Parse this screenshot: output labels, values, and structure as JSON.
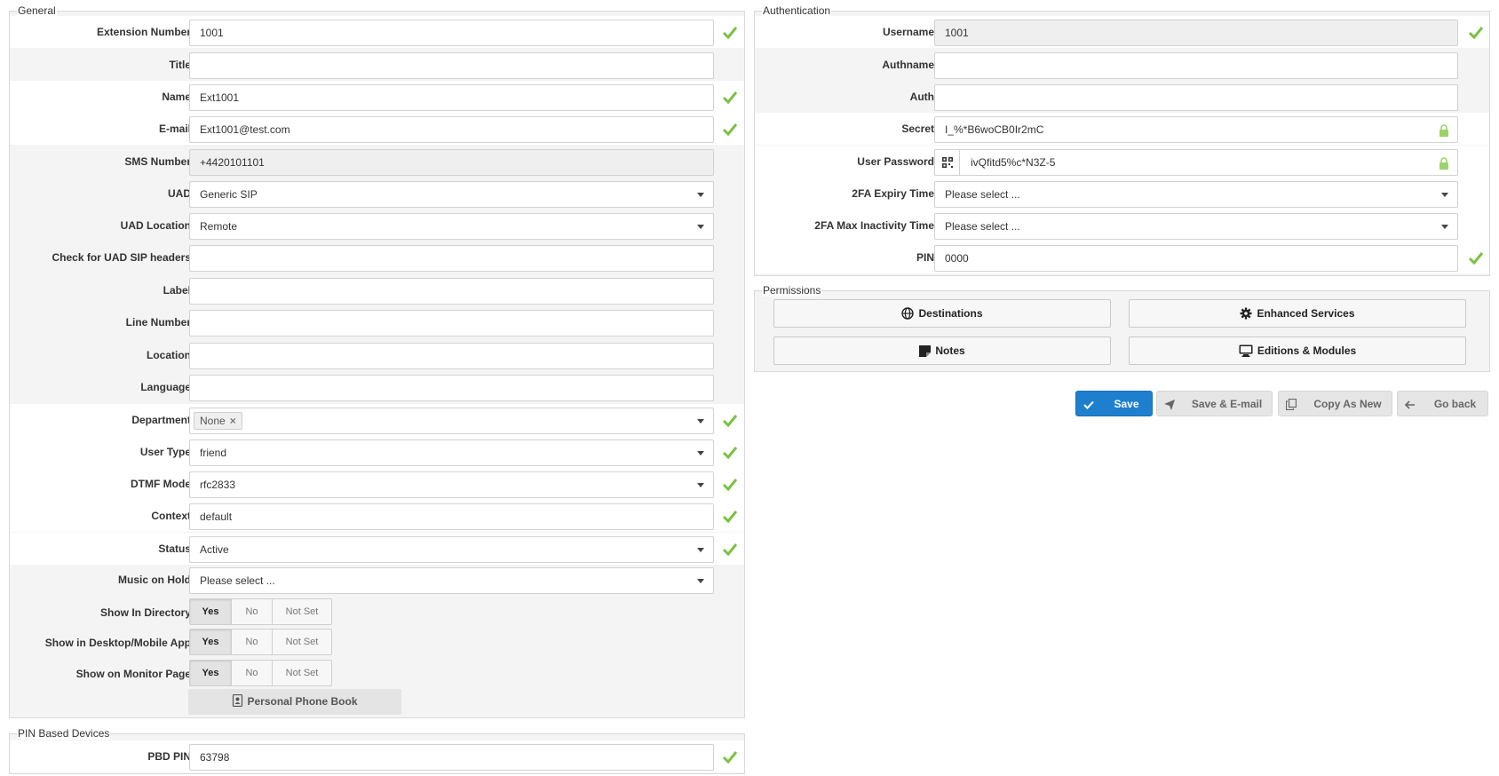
{
  "general": {
    "legend": "General",
    "extension_number": {
      "label": "Extension Number:",
      "value": "1001"
    },
    "title": {
      "label": "Title:",
      "value": ""
    },
    "name": {
      "label": "Name:",
      "value": "Ext1001"
    },
    "email": {
      "label": "E-mail:",
      "value": "Ext1001@test.com"
    },
    "sms_number": {
      "label": "SMS Number:",
      "value": "+4420101101"
    },
    "uad": {
      "label": "UAD:",
      "value": "Generic SIP"
    },
    "uad_location": {
      "label": "UAD Location:",
      "value": "Remote"
    },
    "uad_sip_headers": {
      "label": "Check for UAD SIP headers:",
      "value": ""
    },
    "label": {
      "label": "Label:",
      "value": ""
    },
    "line_number": {
      "label": "Line Number:",
      "value": ""
    },
    "location": {
      "label": "Location:",
      "value": ""
    },
    "language": {
      "label": "Language:",
      "value": ""
    },
    "department": {
      "label": "Department:",
      "tag": "None",
      "tag_remove": "×"
    },
    "user_type": {
      "label": "User Type:",
      "value": "friend"
    },
    "dtmf_mode": {
      "label": "DTMF Mode:",
      "value": "rfc2833"
    },
    "context": {
      "label": "Context:",
      "value": "default"
    },
    "status": {
      "label": "Status:",
      "value": "Active"
    },
    "music_on_hold": {
      "label": "Music on Hold:",
      "value": "Please select ..."
    },
    "toggle_options": [
      "Yes",
      "No",
      "Not Set"
    ],
    "show_in_directory": {
      "label": "Show In Directory:",
      "selected": "Yes"
    },
    "show_in_app": {
      "label": "Show in Desktop/Mobile App:",
      "selected": "Yes"
    },
    "show_on_monitor": {
      "label": "Show on Monitor Page:",
      "selected": "Yes"
    },
    "personal_phone_book": "Personal Phone Book"
  },
  "pin_devices": {
    "legend": "PIN Based Devices",
    "pbd_pin": {
      "label": "PBD PIN:",
      "value": "63798"
    }
  },
  "authentication": {
    "legend": "Authentication",
    "username": {
      "label": "Username:",
      "value": "1001"
    },
    "authname": {
      "label": "Authname:",
      "value": ""
    },
    "auth": {
      "label": "Auth:",
      "value": ""
    },
    "secret": {
      "label": "Secret:",
      "value": "I_%*B6woCB0Ir2mC"
    },
    "user_password": {
      "label": "User Password:",
      "value": "ivQfitd5%c*N3Z-5"
    },
    "twofa_expiry": {
      "label": "2FA Expiry Time:",
      "value": "Please select ..."
    },
    "twofa_inactivity": {
      "label": "2FA Max Inactivity Time:",
      "value": "Please select ..."
    },
    "pin": {
      "label": "PIN:",
      "value": "0000"
    }
  },
  "permissions": {
    "legend": "Permissions",
    "destinations": "Destinations",
    "enhanced_services": "Enhanced Services",
    "notes": "Notes",
    "editions_modules": "Editions & Modules"
  },
  "actions": {
    "save": "Save",
    "save_email": "Save & E-mail",
    "copy_as_new": "Copy As New",
    "go_back": "Go back"
  },
  "colors": {
    "accent": "#1e7fcf",
    "valid": "#7bc143",
    "panel": "#f4f4f4",
    "lock": "#9bd36a"
  }
}
